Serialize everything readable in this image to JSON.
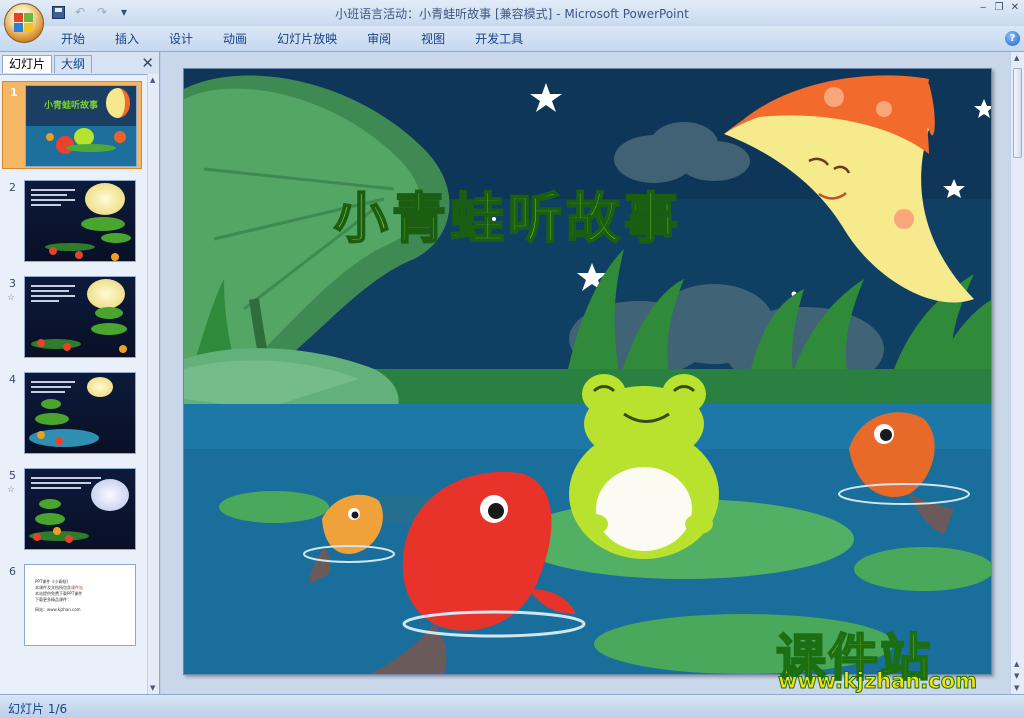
{
  "window": {
    "title_doc": "小班语言活动：小青蛙听故事 [兼容模式]",
    "title_sep": " - ",
    "title_app": "Microsoft PowerPoint"
  },
  "qat": {
    "undo": "↶",
    "redo": "↷",
    "more": "▾"
  },
  "ribbon": {
    "tabs": [
      "开始",
      "插入",
      "设计",
      "动画",
      "幻灯片放映",
      "审阅",
      "视图",
      "开发工具"
    ],
    "help": "?"
  },
  "window_controls": {
    "minimize": "‒",
    "restore": "❐",
    "close": "✕"
  },
  "pane": {
    "tab_slides": "幻灯片",
    "tab_outline": "大纲",
    "close": "✕"
  },
  "slides": [
    {
      "num": "1",
      "anim": ""
    },
    {
      "num": "2",
      "anim": ""
    },
    {
      "num": "3",
      "anim": "☆"
    },
    {
      "num": "4",
      "anim": ""
    },
    {
      "num": "5",
      "anim": "☆"
    },
    {
      "num": "6",
      "anim": ""
    }
  ],
  "thumb1_title": "小青蛙听故事",
  "thumb6": {
    "line1": "PPT课件《小青蛙》",
    "line2_a": "本课件及文档所包含",
    "line2_red": "课件站",
    "line3": "本站提供免费下载PPT课件",
    "line4": "下载更多精品课件：",
    "site_label": "网站：www.kjzhan.com"
  },
  "slide": {
    "title": "小青蛙听故事"
  },
  "watermark": {
    "brand": "课件站",
    "url": "www.kjzhan.com"
  },
  "status": {
    "slide_counter": "幻灯片 1/6"
  },
  "colors": {
    "accent": "#f6b764",
    "ribbon_text": "#15428b",
    "title_green": "#7cd12d"
  }
}
